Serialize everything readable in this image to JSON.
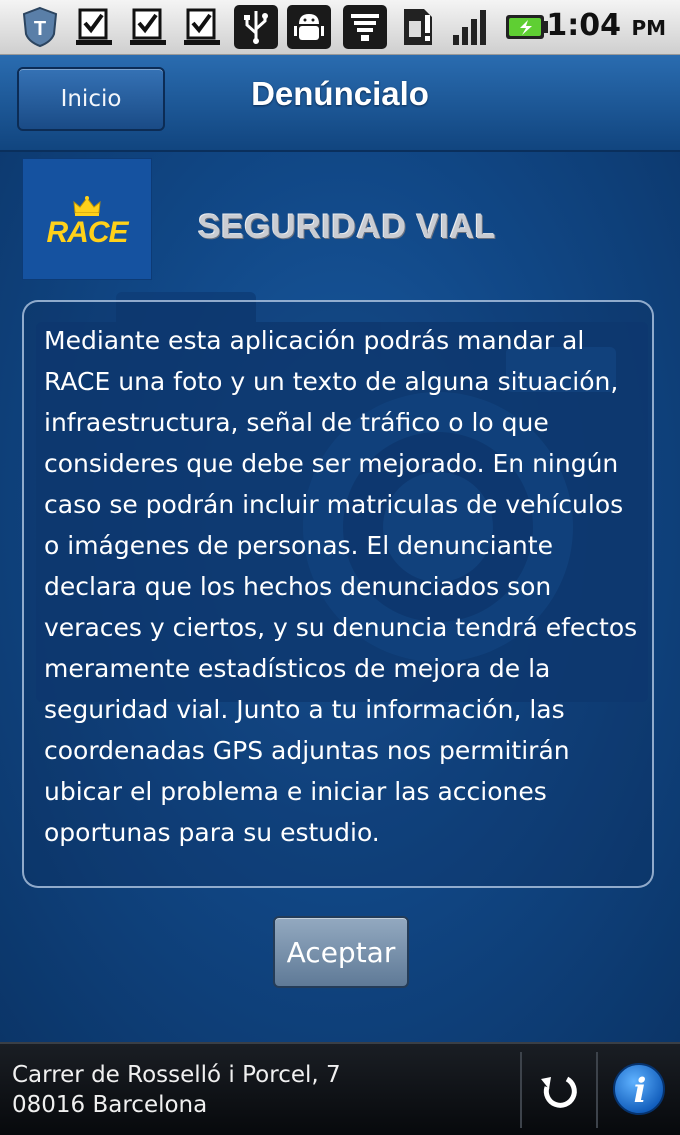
{
  "status_bar": {
    "time": "1:04",
    "ampm": "PM",
    "icons": [
      "shield-app-icon",
      "checklist-icon",
      "checklist-icon",
      "checklist-icon",
      "usb-icon",
      "android-debug-icon",
      "wifi-icon",
      "sim-alert-icon",
      "signal-icon",
      "battery-charging-icon"
    ]
  },
  "header": {
    "home_label": "Inicio",
    "title": "Denúncialo"
  },
  "logo": {
    "text": "RACE",
    "color": "#ffd11a"
  },
  "section_title": "SEGURIDAD VIAL",
  "description": "Mediante esta aplicación podrás mandar al RACE una foto y un texto de alguna situación, infraestructura, señal de tráfico o lo que consideres que debe ser mejorado. En ningún caso se podrán incluir matriculas de vehículos o imágenes de personas. El denunciante declara que los hechos denunciados son veraces y ciertos, y su denuncia tendrá efectos meramente estadísticos de mejora de la seguridad vial. Junto a tu información, las coordenadas GPS adjuntas nos permitirán ubicar el problema e iniciar las acciones oportunas para su estudio.",
  "accept_label": "Aceptar",
  "footer": {
    "address_line1": "Carrer de Rosselló i Porcel, 7",
    "address_line2": "08016 Barcelona",
    "refresh_icon": "refresh-icon",
    "info_icon": "info-icon"
  }
}
